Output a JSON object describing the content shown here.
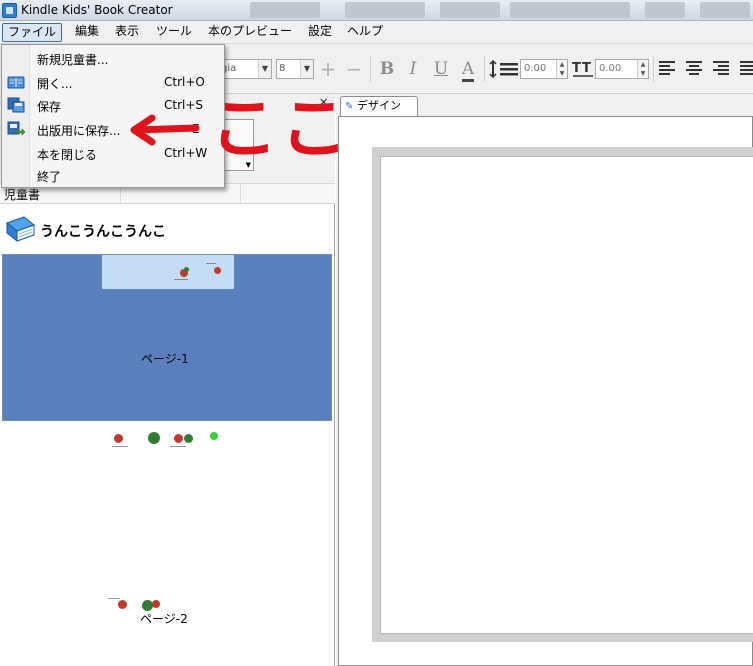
{
  "window": {
    "title": "Kindle Kids' Book Creator"
  },
  "menubar": {
    "items": [
      {
        "label": "ファイル",
        "open": true
      },
      {
        "label": "編集"
      },
      {
        "label": "表示"
      },
      {
        "label": "ツール"
      },
      {
        "label": "本のプレビュー"
      },
      {
        "label": "設定"
      },
      {
        "label": "ヘルプ"
      }
    ]
  },
  "toolbar": {
    "font_name": "orgia",
    "font_size": "8",
    "line_spacing": "0.00",
    "char_spacing": "0.00",
    "icons": [
      "zoom-in-icon",
      "zoom-out-icon",
      "bold-icon",
      "italic-icon",
      "underline-icon",
      "font-color-icon",
      "line-spacing-icon",
      "char-spacing-icon",
      "align-left-icon",
      "align-center-icon",
      "align-right-icon",
      "justify-icon"
    ]
  },
  "file_menu": {
    "items": [
      {
        "label": "新規児童書...",
        "shortcut": "",
        "icon": ""
      },
      {
        "label": "開く...",
        "shortcut": "Ctrl+O",
        "icon": "open-book-icon"
      },
      {
        "label": "保存",
        "shortcut": "Ctrl+S",
        "icon": "save-icon"
      },
      {
        "label": "出版用に保存...",
        "shortcut": "E",
        "icon": "publish-save-icon"
      },
      {
        "label": "本を閉じる",
        "shortcut": "Ctrl+W",
        "icon": ""
      },
      {
        "label": "終了",
        "shortcut": "",
        "icon": ""
      }
    ]
  },
  "left_panel": {
    "column_header": "児童書",
    "book_title": "うんこうんこうんこ",
    "pages": [
      {
        "label": "ページ-1",
        "selected": true
      },
      {
        "label": "ページ-2",
        "selected": false
      }
    ]
  },
  "design_tab": {
    "label": "デザイン"
  },
  "annotation": {
    "text": "ここ",
    "color": "#e0121b"
  },
  "colors": {
    "selection": "#5a7fbd",
    "menu_highlight": "#dbe6f3",
    "accent": "#2f7fd1"
  }
}
